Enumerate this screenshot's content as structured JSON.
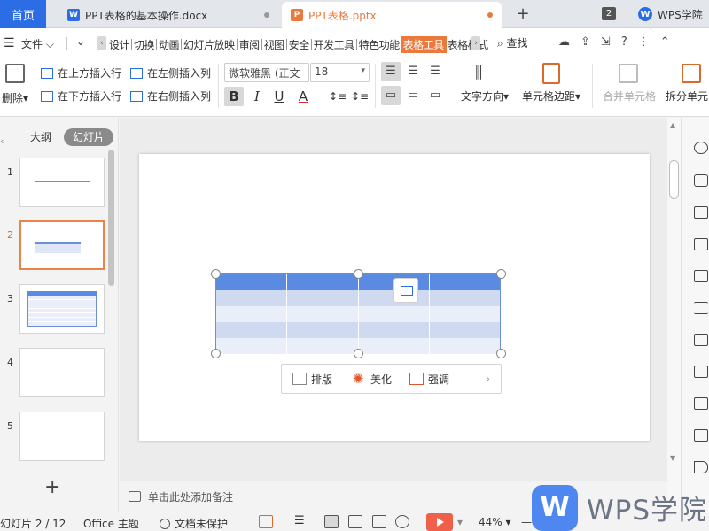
{
  "tabs": {
    "home": "首页",
    "doc1": {
      "name": "PPT表格的基本操作.docx",
      "icon": "W"
    },
    "doc2": {
      "name": "PPT表格.pptx",
      "icon": "P"
    },
    "count": "2",
    "academy": "WPS学院",
    "academy_icon": "W"
  },
  "menu": {
    "file": "文件",
    "items": [
      "设计",
      "切换",
      "动画",
      "幻灯片放映",
      "审阅",
      "视图",
      "安全",
      "开发工具",
      "特色功能",
      "表格工具",
      "表格样式"
    ],
    "active": "表格工具",
    "search": "查找"
  },
  "toolbar": {
    "delete": "删除",
    "insert_above": "在上方插入行",
    "insert_below": "在下方插入行",
    "insert_left": "在左侧插入列",
    "insert_right": "在右侧插入列",
    "font": "微软雅黑 (正文",
    "size": "18",
    "bold": "B",
    "italic": "I",
    "underline": "U",
    "font_color": "A",
    "text_dir": "文字方向",
    "cell_margin": "单元格边距",
    "merge": "合并单元格",
    "split": "拆分单元"
  },
  "panel": {
    "outline": "大纲",
    "slides_tab": "幻灯片",
    "slides": [
      {
        "num": "1"
      },
      {
        "num": "2"
      },
      {
        "num": "3"
      },
      {
        "num": "4"
      },
      {
        "num": "5"
      }
    ]
  },
  "context_bar": {
    "arrange": "排版",
    "beautify": "美化",
    "emphasize": "强调"
  },
  "notes": "单击此处添加备注",
  "status": {
    "slide": "幻灯片 2 / 12",
    "theme": "Office 主题",
    "protect": "文档未保护",
    "zoom": "44%",
    "zoom_level": 0.44
  },
  "watermark": {
    "text": "WPS学院",
    "logo": "W"
  },
  "colors": {
    "accent": "#2b6de5",
    "orange": "#e97a3c",
    "table_head": "#5a8be0"
  }
}
